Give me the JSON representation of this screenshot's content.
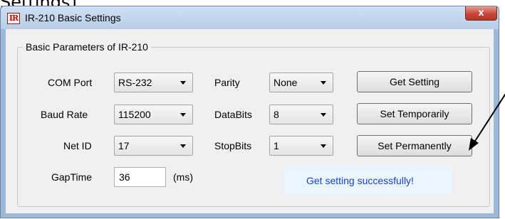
{
  "caption": "Settings].",
  "window": {
    "title": "IR-210 Basic Settings",
    "icon_text": "IR",
    "close_glyph": "x",
    "group_title": "Basic Parameters of IR-210"
  },
  "fields": {
    "com_port": {
      "label": "COM Port",
      "value": "RS-232"
    },
    "baud_rate": {
      "label": "Baud Rate",
      "value": "115200"
    },
    "net_id": {
      "label": "Net ID",
      "value": "17"
    },
    "parity": {
      "label": "Parity",
      "value": "None"
    },
    "databits": {
      "label": "DataBits",
      "value": "8"
    },
    "stopbits": {
      "label": "StopBits",
      "value": "1"
    },
    "gap_time": {
      "label": "GapTime",
      "value": "36",
      "unit": "(ms)"
    }
  },
  "buttons": {
    "get_setting": "Get Setting",
    "set_temporarily": "Set Temporarily",
    "set_permanently": "Set Permanently"
  },
  "status": {
    "text": "Get setting successfully!",
    "color": "#1a3fd0"
  },
  "colors": {
    "title_bar": "#b7cde8",
    "close_button": "#c7453a",
    "arrow": "#000000"
  }
}
